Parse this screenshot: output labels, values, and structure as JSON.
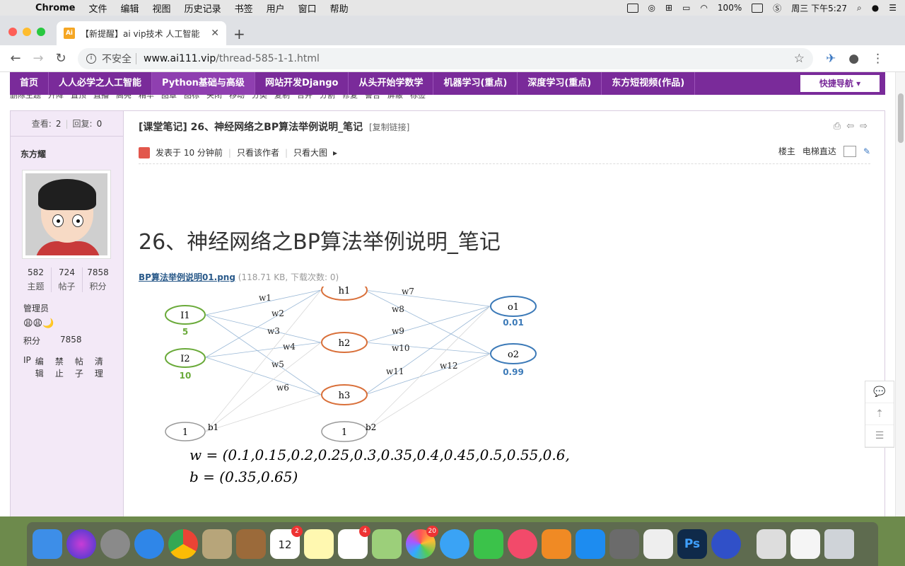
{
  "menubar": {
    "app": "Chrome",
    "items": [
      "文件",
      "编辑",
      "视图",
      "历史记录",
      "书签",
      "用户",
      "窗口",
      "帮助"
    ],
    "battery": "100%",
    "clock": "周三 下午5:27"
  },
  "browser": {
    "tab_title": "【新提醒】ai vip技术 人工智能",
    "insecure_label": "不安全",
    "url_host": "www.ai111.vip",
    "url_path": "/thread-585-1-1.html"
  },
  "site_nav": {
    "items": [
      "首页",
      "人人必学之人工智能",
      "Python基础与高级",
      "网站开发Django",
      "从头开始学数学",
      "机器学习(重点)",
      "深度学习(重点)",
      "东方短视频(作品)"
    ],
    "quick_nav": "快捷导航"
  },
  "mod_bar": [
    "删除主题",
    "升降",
    "置顶",
    "直播",
    "高亮",
    "精华",
    "图章",
    "图标",
    "关闭",
    "移动",
    "分类",
    "复制",
    "合并",
    "分割",
    "修复",
    "警告",
    "屏蔽",
    "标签"
  ],
  "sidebar": {
    "views_label": "查看:",
    "views": "2",
    "replies_label": "回复:",
    "replies": "0",
    "author": "东方耀",
    "stats": [
      {
        "value": "582",
        "label": "主题"
      },
      {
        "value": "724",
        "label": "帖子"
      },
      {
        "value": "7858",
        "label": "积分"
      }
    ],
    "role": "管理员",
    "points_label": "积分",
    "points": "7858",
    "admin_links": [
      "IP",
      "编辑",
      "禁止",
      "帖子",
      "清理"
    ]
  },
  "post": {
    "thread_title": "[课堂笔记] 26、神经网络之BP算法举例说明_笔记",
    "copy_link": "[复制链接]",
    "posted": "发表于 10 分钟前",
    "author_only": "只看该作者",
    "big_image": "只看大图",
    "floor": "楼主",
    "elevator": "电梯直达",
    "heading": "26、神经网络之BP算法举例说明_笔记",
    "attachment_name": "BP算法举例说明01.png",
    "attachment_info": "(118.71 KB, 下载次数: 0)"
  },
  "diagram": {
    "inputs": [
      {
        "label": "I1",
        "value": "5"
      },
      {
        "label": "I2",
        "value": "10"
      }
    ],
    "hidden": [
      "h1",
      "h2",
      "h3"
    ],
    "outputs": [
      {
        "label": "o1",
        "value": "0.01"
      },
      {
        "label": "o2",
        "value": "0.99"
      }
    ],
    "bias": [
      "1",
      "1"
    ],
    "bias_labels": [
      "b1",
      "b2"
    ],
    "weights": [
      "w1",
      "w2",
      "w3",
      "w4",
      "w5",
      "w6",
      "w7",
      "w8",
      "w9",
      "w10",
      "w11",
      "w12"
    ],
    "formula_w": "w = (0.1,0.15,0.2,0.25,0.3,0.35,0.4,0.45,0.5,0.55,0.6,0.65)",
    "formula_b": "b = (0.35,0.65)",
    "colors": {
      "input": "#6aaa3a",
      "hidden": "#d9703a",
      "output": "#3c7ab8",
      "bias": "#999999"
    }
  },
  "dock": {
    "badges": {
      "calendar": "2",
      "reminders": "4",
      "photos": "20"
    },
    "calendar_month": "12月",
    "calendar_day": "12"
  }
}
